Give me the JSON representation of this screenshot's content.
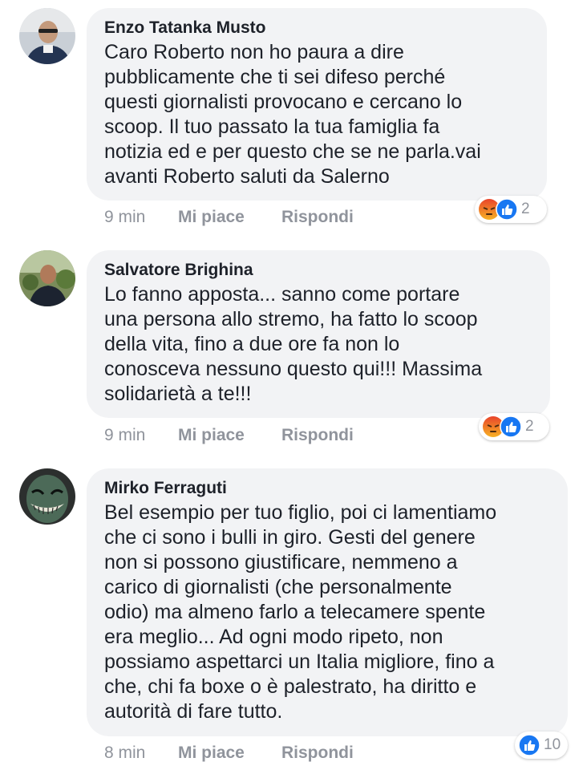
{
  "comments": [
    {
      "author": "Enzo Tatanka Musto",
      "text": "Caro Roberto non ho paura a dire\npubblicamente che ti sei difeso perché\nquesti giornalisti provocano e cercano lo\nscoop. Il tuo passato la tua famiglia fa\nnotizia ed e per questo che se ne parla.vai\navanti Roberto saluti da Salerno",
      "time": "9 min",
      "like_label": "Mi piace",
      "reply_label": "Rispondi",
      "reactions": [
        "angry-icon",
        "like-icon"
      ],
      "reaction_count": "2"
    },
    {
      "author": "Salvatore Brighina",
      "text": "Lo fanno apposta...  sanno come portare\nuna persona allo stremo, ha fatto lo scoop\ndella vita, fino a due ore fa non lo\nconosceva nessuno questo qui!!! Massima\nsolidarietà a te!!!",
      "time": "9 min",
      "like_label": "Mi piace",
      "reply_label": "Rispondi",
      "reactions": [
        "angry-icon",
        "like-icon"
      ],
      "reaction_count": "2"
    },
    {
      "author": "Mirko Ferraguti",
      "text": "Bel esempio per tuo figlio, poi ci lamentiamo\nche ci sono i bulli in giro. Gesti del genere\nnon si possono giustificare, nemmeno a\ncarico di giornalisti (che personalmente\nodio) ma almeno farlo a telecamere spente\nera meglio... Ad ogni modo ripeto, non\npossiamo aspettarci un Italia migliore, fino a\nche, chi fa boxe o è palestrato, ha diritto e\nautorità di fare tutto.",
      "time": "8 min",
      "like_label": "Mi piace",
      "reply_label": "Rispondi",
      "reactions": [
        "like-icon"
      ],
      "reaction_count": "10"
    }
  ],
  "colors": {
    "bubble_bg": "#f2f3f5",
    "meta_text": "#90949c",
    "like_blue": "#1877f2",
    "angry_orange": "#e9710f"
  }
}
